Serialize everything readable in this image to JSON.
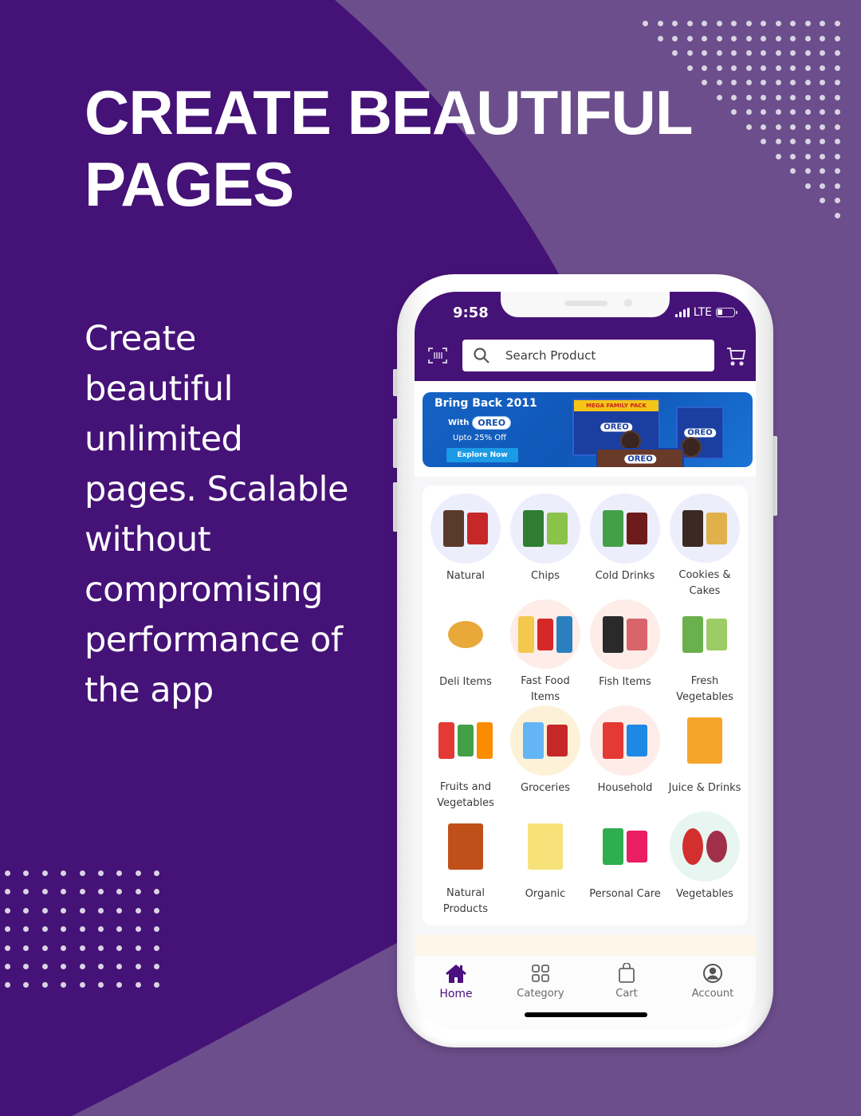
{
  "poster": {
    "headline_line1": "CREATE BEAUTIFUL",
    "headline_line2": "PAGES",
    "body_lines": [
      "Create",
      "beautiful",
      "unlimited",
      "pages. Scalable",
      "without",
      "compromising",
      "performance of",
      "the app"
    ],
    "colors": {
      "dark_purple": "#451277",
      "light_purple": "#6c4e8c",
      "dots": "#d9d4e2",
      "text": "#ffffff"
    }
  },
  "app": {
    "status_bar": {
      "time": "9:58",
      "network": "LTE"
    },
    "header": {
      "scan_icon": "barcode-scan-icon",
      "search_placeholder": "Search Product",
      "cart_icon": "cart-icon",
      "accent": "#451277"
    },
    "banner": {
      "title": "Bring Back 2011",
      "with_label": "With",
      "brand": "OREO",
      "offer": "Upto 25% Off",
      "cta": "Explore Now",
      "pack_band": "MEGA FAMILY PACK"
    },
    "categories": [
      {
        "label": "Natural",
        "bg": "#eceefb"
      },
      {
        "label": "Chips",
        "bg": "#eceefb"
      },
      {
        "label": "Cold Drinks",
        "bg": "#eceefb"
      },
      {
        "label": "Cookies & Cakes",
        "bg": "#eceefb"
      },
      {
        "label": "Deli Items",
        "bg": "#ffffff"
      },
      {
        "label": "Fast Food Items",
        "bg": "#fdece8"
      },
      {
        "label": "Fish Items",
        "bg": "#fdece8"
      },
      {
        "label": "Fresh Vegetables",
        "bg": "#ffffff"
      },
      {
        "label": "Fruits and Vegetables",
        "bg": "#ffffff"
      },
      {
        "label": "Groceries",
        "bg": "#fdf1d8"
      },
      {
        "label": "Household",
        "bg": "#fdece8"
      },
      {
        "label": "Juice & Drinks",
        "bg": "#ffffff"
      },
      {
        "label": "Natural Products",
        "bg": "#ffffff"
      },
      {
        "label": "Organic",
        "bg": "#ffffff"
      },
      {
        "label": "Personal Care",
        "bg": "#ffffff"
      },
      {
        "label": "Vegetables",
        "bg": "#e8f6f1"
      }
    ],
    "bottom_nav": [
      {
        "label": "Home",
        "icon": "home-icon",
        "active": true
      },
      {
        "label": "Category",
        "icon": "grid-icon",
        "active": false
      },
      {
        "label": "Cart",
        "icon": "bag-icon",
        "active": false
      },
      {
        "label": "Account",
        "icon": "account-icon",
        "active": false
      }
    ]
  }
}
